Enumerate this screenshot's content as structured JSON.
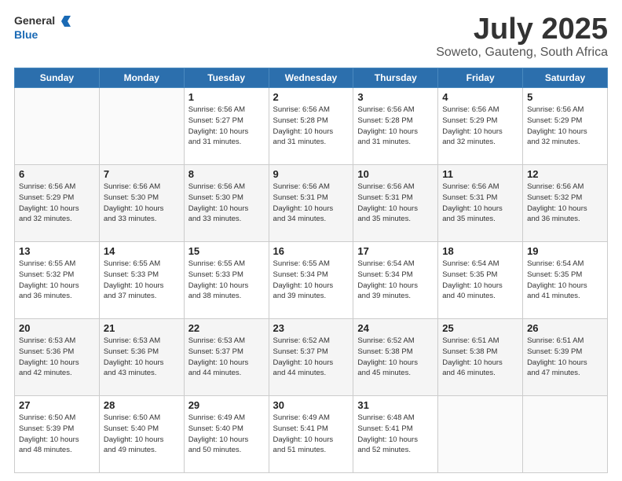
{
  "header": {
    "logo_general": "General",
    "logo_blue": "Blue",
    "month": "July 2025",
    "location": "Soweto, Gauteng, South Africa"
  },
  "days_of_week": [
    "Sunday",
    "Monday",
    "Tuesday",
    "Wednesday",
    "Thursday",
    "Friday",
    "Saturday"
  ],
  "weeks": [
    [
      {
        "day": "",
        "info": ""
      },
      {
        "day": "",
        "info": ""
      },
      {
        "day": "1",
        "info": "Sunrise: 6:56 AM\nSunset: 5:27 PM\nDaylight: 10 hours\nand 31 minutes."
      },
      {
        "day": "2",
        "info": "Sunrise: 6:56 AM\nSunset: 5:28 PM\nDaylight: 10 hours\nand 31 minutes."
      },
      {
        "day": "3",
        "info": "Sunrise: 6:56 AM\nSunset: 5:28 PM\nDaylight: 10 hours\nand 31 minutes."
      },
      {
        "day": "4",
        "info": "Sunrise: 6:56 AM\nSunset: 5:29 PM\nDaylight: 10 hours\nand 32 minutes."
      },
      {
        "day": "5",
        "info": "Sunrise: 6:56 AM\nSunset: 5:29 PM\nDaylight: 10 hours\nand 32 minutes."
      }
    ],
    [
      {
        "day": "6",
        "info": "Sunrise: 6:56 AM\nSunset: 5:29 PM\nDaylight: 10 hours\nand 32 minutes."
      },
      {
        "day": "7",
        "info": "Sunrise: 6:56 AM\nSunset: 5:30 PM\nDaylight: 10 hours\nand 33 minutes."
      },
      {
        "day": "8",
        "info": "Sunrise: 6:56 AM\nSunset: 5:30 PM\nDaylight: 10 hours\nand 33 minutes."
      },
      {
        "day": "9",
        "info": "Sunrise: 6:56 AM\nSunset: 5:31 PM\nDaylight: 10 hours\nand 34 minutes."
      },
      {
        "day": "10",
        "info": "Sunrise: 6:56 AM\nSunset: 5:31 PM\nDaylight: 10 hours\nand 35 minutes."
      },
      {
        "day": "11",
        "info": "Sunrise: 6:56 AM\nSunset: 5:31 PM\nDaylight: 10 hours\nand 35 minutes."
      },
      {
        "day": "12",
        "info": "Sunrise: 6:56 AM\nSunset: 5:32 PM\nDaylight: 10 hours\nand 36 minutes."
      }
    ],
    [
      {
        "day": "13",
        "info": "Sunrise: 6:55 AM\nSunset: 5:32 PM\nDaylight: 10 hours\nand 36 minutes."
      },
      {
        "day": "14",
        "info": "Sunrise: 6:55 AM\nSunset: 5:33 PM\nDaylight: 10 hours\nand 37 minutes."
      },
      {
        "day": "15",
        "info": "Sunrise: 6:55 AM\nSunset: 5:33 PM\nDaylight: 10 hours\nand 38 minutes."
      },
      {
        "day": "16",
        "info": "Sunrise: 6:55 AM\nSunset: 5:34 PM\nDaylight: 10 hours\nand 39 minutes."
      },
      {
        "day": "17",
        "info": "Sunrise: 6:54 AM\nSunset: 5:34 PM\nDaylight: 10 hours\nand 39 minutes."
      },
      {
        "day": "18",
        "info": "Sunrise: 6:54 AM\nSunset: 5:35 PM\nDaylight: 10 hours\nand 40 minutes."
      },
      {
        "day": "19",
        "info": "Sunrise: 6:54 AM\nSunset: 5:35 PM\nDaylight: 10 hours\nand 41 minutes."
      }
    ],
    [
      {
        "day": "20",
        "info": "Sunrise: 6:53 AM\nSunset: 5:36 PM\nDaylight: 10 hours\nand 42 minutes."
      },
      {
        "day": "21",
        "info": "Sunrise: 6:53 AM\nSunset: 5:36 PM\nDaylight: 10 hours\nand 43 minutes."
      },
      {
        "day": "22",
        "info": "Sunrise: 6:53 AM\nSunset: 5:37 PM\nDaylight: 10 hours\nand 44 minutes."
      },
      {
        "day": "23",
        "info": "Sunrise: 6:52 AM\nSunset: 5:37 PM\nDaylight: 10 hours\nand 44 minutes."
      },
      {
        "day": "24",
        "info": "Sunrise: 6:52 AM\nSunset: 5:38 PM\nDaylight: 10 hours\nand 45 minutes."
      },
      {
        "day": "25",
        "info": "Sunrise: 6:51 AM\nSunset: 5:38 PM\nDaylight: 10 hours\nand 46 minutes."
      },
      {
        "day": "26",
        "info": "Sunrise: 6:51 AM\nSunset: 5:39 PM\nDaylight: 10 hours\nand 47 minutes."
      }
    ],
    [
      {
        "day": "27",
        "info": "Sunrise: 6:50 AM\nSunset: 5:39 PM\nDaylight: 10 hours\nand 48 minutes."
      },
      {
        "day": "28",
        "info": "Sunrise: 6:50 AM\nSunset: 5:40 PM\nDaylight: 10 hours\nand 49 minutes."
      },
      {
        "day": "29",
        "info": "Sunrise: 6:49 AM\nSunset: 5:40 PM\nDaylight: 10 hours\nand 50 minutes."
      },
      {
        "day": "30",
        "info": "Sunrise: 6:49 AM\nSunset: 5:41 PM\nDaylight: 10 hours\nand 51 minutes."
      },
      {
        "day": "31",
        "info": "Sunrise: 6:48 AM\nSunset: 5:41 PM\nDaylight: 10 hours\nand 52 minutes."
      },
      {
        "day": "",
        "info": ""
      },
      {
        "day": "",
        "info": ""
      }
    ]
  ]
}
